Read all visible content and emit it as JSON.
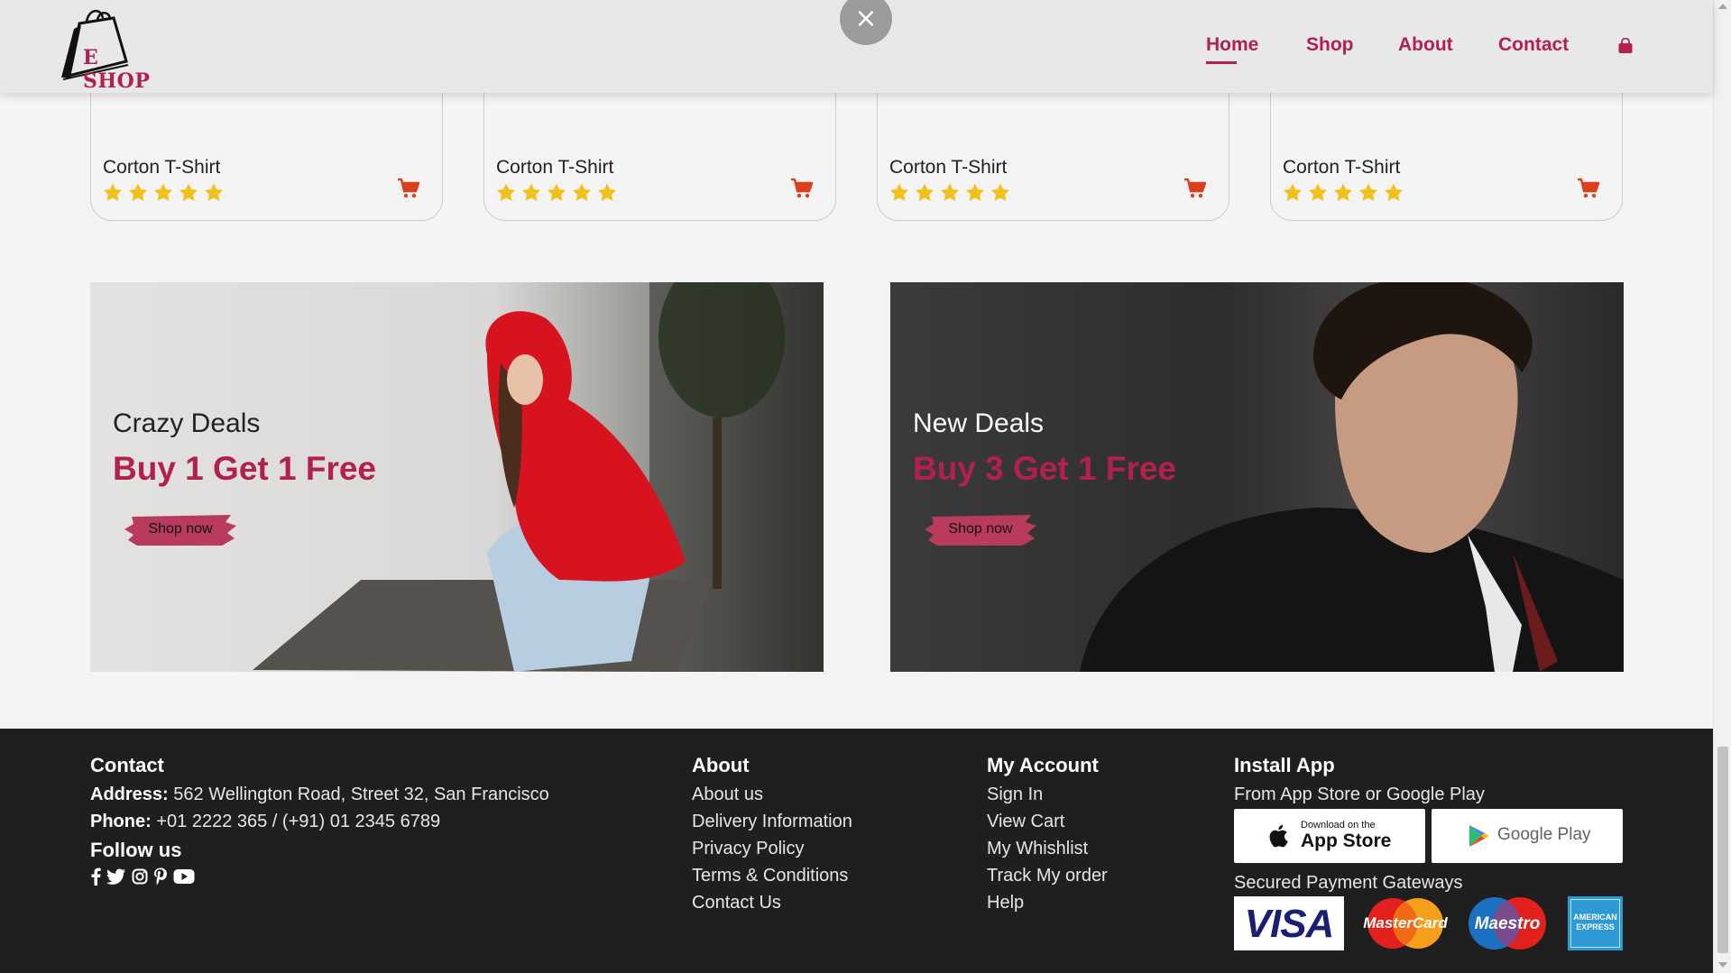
{
  "header": {
    "logo_text": "E SHOP",
    "nav": [
      "Home",
      "Shop",
      "About",
      "Contact"
    ],
    "active_nav": "Home",
    "close_label": "×"
  },
  "products": [
    {
      "title": "Corton T-Shirt",
      "rating": 5
    },
    {
      "title": "Corton T-Shirt",
      "rating": 5
    },
    {
      "title": "Corton T-Shirt",
      "rating": 5
    },
    {
      "title": "Corton T-Shirt",
      "rating": 5
    }
  ],
  "banners": [
    {
      "subtitle": "Crazy Deals",
      "headline": "Buy 1 Get 1 Free",
      "button": "Shop now"
    },
    {
      "subtitle": "New Deals",
      "headline": "Buy 3 Get 1 Free",
      "button": "Shop now"
    }
  ],
  "footer": {
    "contact": {
      "heading": "Contact",
      "address_label": "Address:",
      "address": "562 Wellington Road, Street 32, San Francisco",
      "phone_label": "Phone:",
      "phone": "+01 2222 365 / (+91) 01 2345 6789",
      "follow": "Follow us",
      "social_icons": [
        "facebook-icon",
        "twitter-icon",
        "instagram-icon",
        "pinterest-icon",
        "youtube-icon"
      ]
    },
    "about": {
      "heading": "About",
      "links": [
        "About us",
        "Delivery Information",
        "Privacy Policy",
        "Terms & Conditions",
        "Contact Us"
      ]
    },
    "account": {
      "heading": "My Account",
      "links": [
        "Sign In",
        "View Cart",
        "My Whishlist",
        "Track My order",
        "Help"
      ]
    },
    "install": {
      "heading": "Install App",
      "subtitle": "From App Store or Google Play",
      "app_store_small": "Download on the",
      "app_store": "App Store",
      "google_play": "Google Play",
      "payments_label": "Secured Payment Gateways",
      "payments": [
        "VISA",
        "MasterCard",
        "Maestro",
        "AMERICAN EXPRESS"
      ]
    }
  },
  "colors": {
    "accent": "#b2204d",
    "cart": "#d9401b",
    "star": "#f3c019",
    "footer_bg": "#1f1f1f"
  }
}
